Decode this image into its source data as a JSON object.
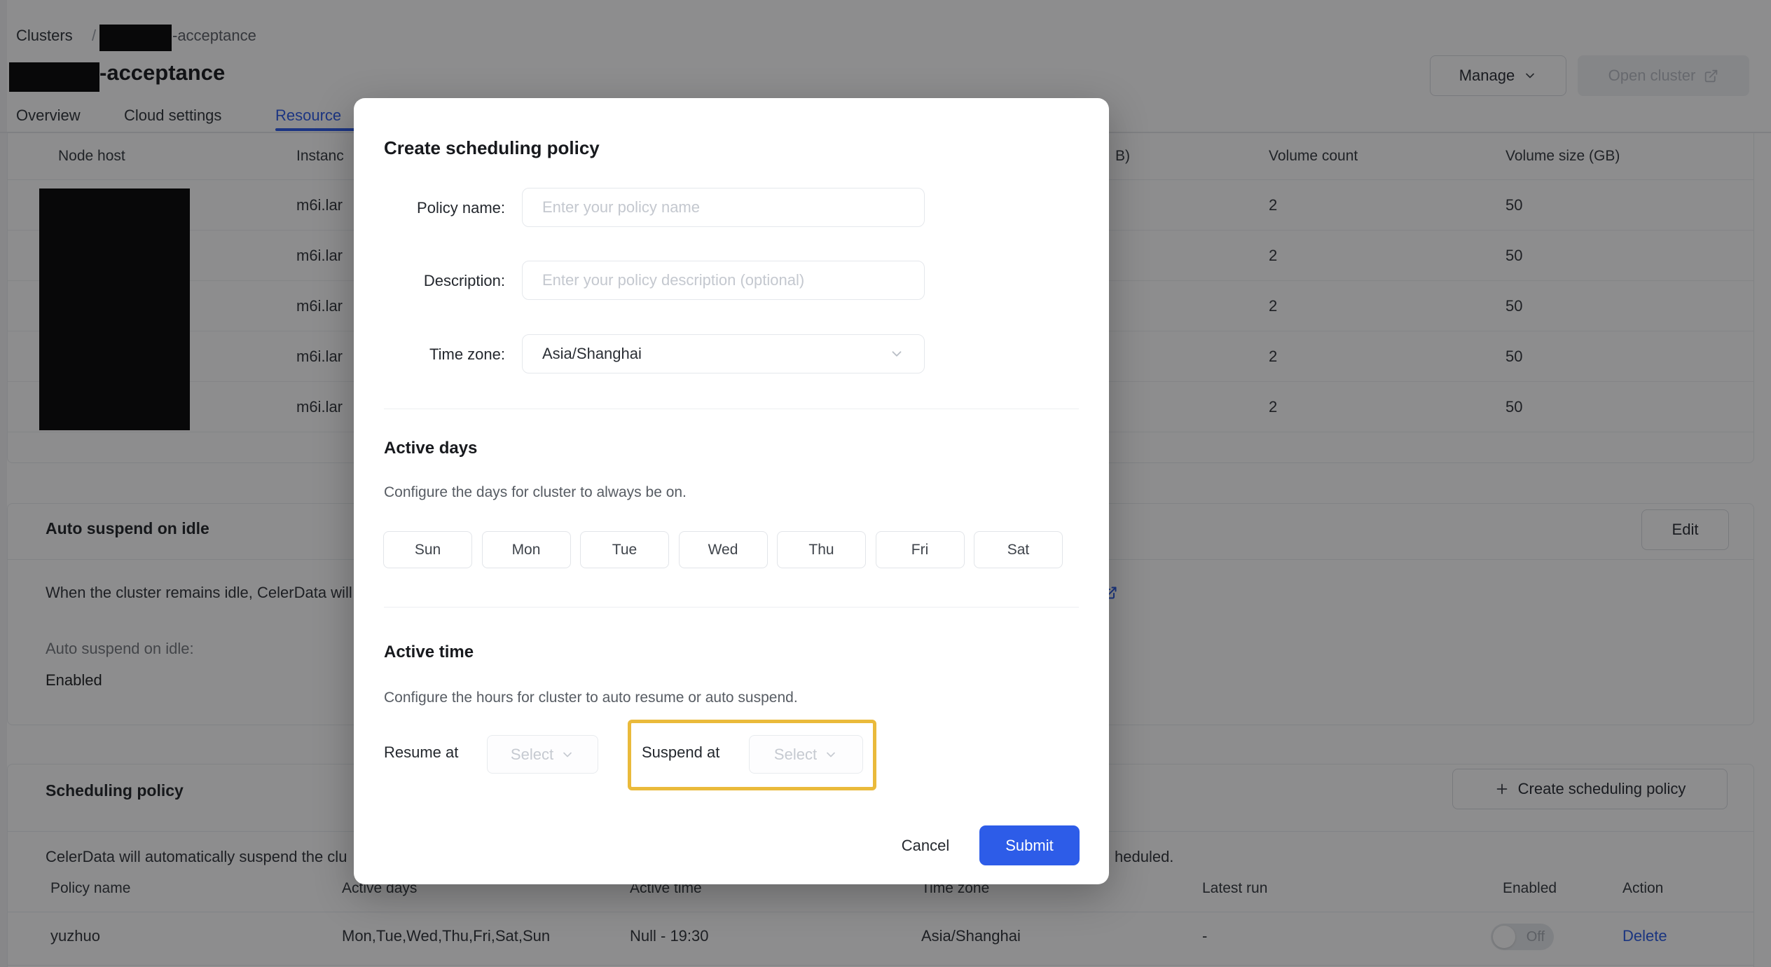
{
  "page": {
    "breadcrumb": {
      "root": "Clusters",
      "separator": "/",
      "current": "-acceptance"
    },
    "title": "-acceptance",
    "header_actions": {
      "manage": "Manage",
      "open_cluster": "Open cluster"
    },
    "tabs": {
      "overview": "Overview",
      "cloud_settings": "Cloud settings",
      "resource": "Resource"
    },
    "nodes_table": {
      "headers": {
        "node_host": "Node host",
        "instance": "Instanc",
        "gb_fragment": "B)",
        "volume_count": "Volume count",
        "volume_size": "Volume size (GB)"
      },
      "rows": [
        {
          "instance": "m6i.lar",
          "volume_count": "2",
          "volume_size": "50"
        },
        {
          "instance": "m6i.lar",
          "volume_count": "2",
          "volume_size": "50"
        },
        {
          "instance": "m6i.lar",
          "volume_count": "2",
          "volume_size": "50"
        },
        {
          "instance": "m6i.lar",
          "volume_count": "2",
          "volume_size": "50"
        },
        {
          "instance": "m6i.lar",
          "volume_count": "2",
          "volume_size": "50"
        }
      ]
    },
    "auto_suspend": {
      "heading": "Auto suspend on idle",
      "edit": "Edit",
      "description": "When the cluster remains idle, CelerData will",
      "field_label": "Auto suspend on idle:",
      "field_value": "Enabled"
    },
    "scheduling": {
      "heading": "Scheduling policy",
      "create_button": "Create scheduling policy",
      "description_left": "CelerData will automatically suspend the clu",
      "description_right": "heduled.",
      "table": {
        "headers": [
          "Policy name",
          "Active days",
          "Active time",
          "Time zone",
          "Latest run",
          "Enabled",
          "Action"
        ],
        "row_cells": [
          "yuzhuo",
          "Mon,Tue,Wed,Thu,Fri,Sat,Sun",
          "Null - 19:30",
          "Asia/Shanghai",
          "-"
        ],
        "toggle_label": "Off",
        "action": "Delete"
      }
    }
  },
  "modal": {
    "title": "Create scheduling policy",
    "fields": {
      "policy_name": {
        "label": "Policy name:",
        "placeholder": "Enter your policy name"
      },
      "description": {
        "label": "Description:",
        "placeholder": "Enter your policy description (optional)"
      },
      "time_zone": {
        "label": "Time zone:",
        "value": "Asia/Shanghai"
      }
    },
    "active_days": {
      "heading": "Active days",
      "description": "Configure the days for cluster to always be on.",
      "days": [
        "Sun",
        "Mon",
        "Tue",
        "Wed",
        "Thu",
        "Fri",
        "Sat"
      ]
    },
    "active_time": {
      "heading": "Active time",
      "description": "Configure the hours for cluster to auto resume or auto suspend.",
      "resume_label": "Resume at",
      "suspend_label": "Suspend at",
      "select_placeholder": "Select"
    },
    "footer": {
      "cancel": "Cancel",
      "submit": "Submit"
    }
  },
  "colors": {
    "accent_blue": "#2757e8",
    "submit_blue": "#2d5ce8",
    "link_blue": "#2456e4",
    "highlight_gold": "#eaba3b"
  }
}
